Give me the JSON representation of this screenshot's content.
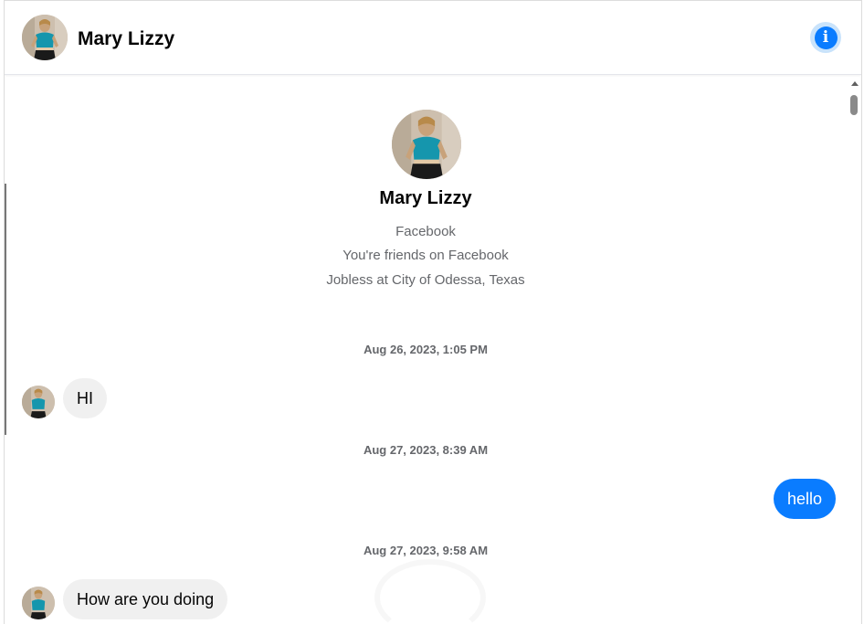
{
  "contact": {
    "name": "Mary Lizzy",
    "avatar_icon": "profile-photo"
  },
  "header": {
    "info_icon": "info-icon",
    "info_glyph": "i",
    "accent_color": "#0a7cff"
  },
  "profile": {
    "name": "Mary Lizzy",
    "lines": [
      "Facebook",
      "You're friends on Facebook",
      "Jobless at City of Odessa, Texas"
    ]
  },
  "conversation": [
    {
      "type": "timestamp",
      "text": "Aug 26, 2023, 1:05 PM"
    },
    {
      "type": "incoming",
      "text": "HI"
    },
    {
      "type": "timestamp",
      "text": "Aug 27, 2023, 8:39 AM"
    },
    {
      "type": "outgoing",
      "text": "hello"
    },
    {
      "type": "timestamp",
      "text": "Aug 27, 2023, 9:58 AM"
    },
    {
      "type": "incoming",
      "text": "How are you doing"
    }
  ],
  "colors": {
    "outgoing_bubble": "#0a7cff",
    "incoming_bubble": "#f0f0f0",
    "secondary_text": "#65676b"
  }
}
